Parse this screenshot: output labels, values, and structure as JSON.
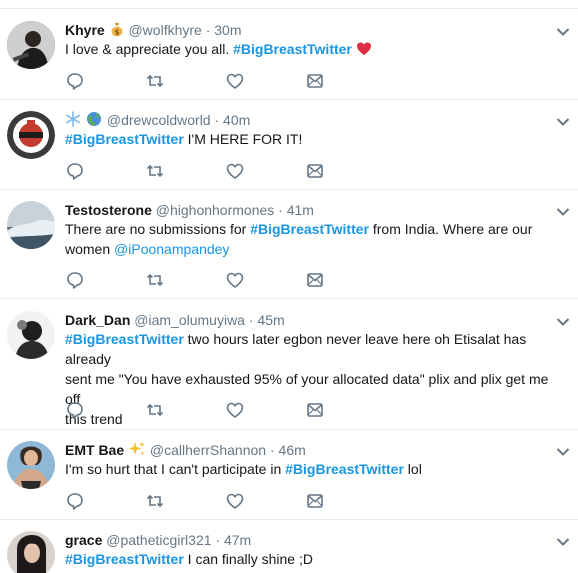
{
  "tweets": [
    {
      "name": "Khyre",
      "handle": "@wolfkhyre",
      "time": "30m",
      "name_emoji": "money-bag-icon",
      "text_before": "I love & appreciate you all. ",
      "hashtag": "#BigBreastTwitter",
      "text_after": "",
      "trailing_icon": "red-heart-icon"
    },
    {
      "name": "",
      "handle": "@drewcoldworld",
      "time": "40m",
      "name_emoji": "snowflake-globe-icon",
      "hashtag": "#BigBreastTwitter",
      "text_after": " I'M HERE FOR IT!"
    },
    {
      "name": "Testosterone",
      "handle": "@highonhormones",
      "time": "41m",
      "text_before": "There are no submissions for ",
      "hashtag": "#BigBreastTwitter",
      "text_after_line1": " from India. Where are our",
      "text_line2": "women ",
      "mention": "@iPoonampandey"
    },
    {
      "name": "Dark_Dan",
      "handle": "@iam_olumuyiwa",
      "time": "45m",
      "hashtag": "#BigBreastTwitter",
      "text_after_line1": " two hours later egbon never leave here oh Etisalat has already",
      "text_line2": "sent me \"You have exhausted 95% of your allocated data\" plix and plix get me off",
      "text_line3": "this trend"
    },
    {
      "name": "EMT Bae",
      "handle": "@callherrShannon",
      "time": "46m",
      "name_emoji": "sparkles-icon",
      "text_before": "I'm so hurt that I can't participate in ",
      "hashtag": "#BigBreastTwitter",
      "text_after": " lol"
    },
    {
      "name": "grace",
      "handle": "@patheticgirl321",
      "time": "47m",
      "hashtag": "#BigBreastTwitter",
      "text_after": " I can finally shine ;D"
    }
  ],
  "dot": "·",
  "icons": {
    "reply": "reply-icon",
    "retweet": "retweet-icon",
    "like": "like-icon",
    "message": "message-icon",
    "more": "chevron-down-icon"
  },
  "colors": {
    "link": "#1b95e0",
    "muted": "#657786",
    "text": "#14171a",
    "border": "#e6ecf0",
    "heart": "#e0245e"
  }
}
